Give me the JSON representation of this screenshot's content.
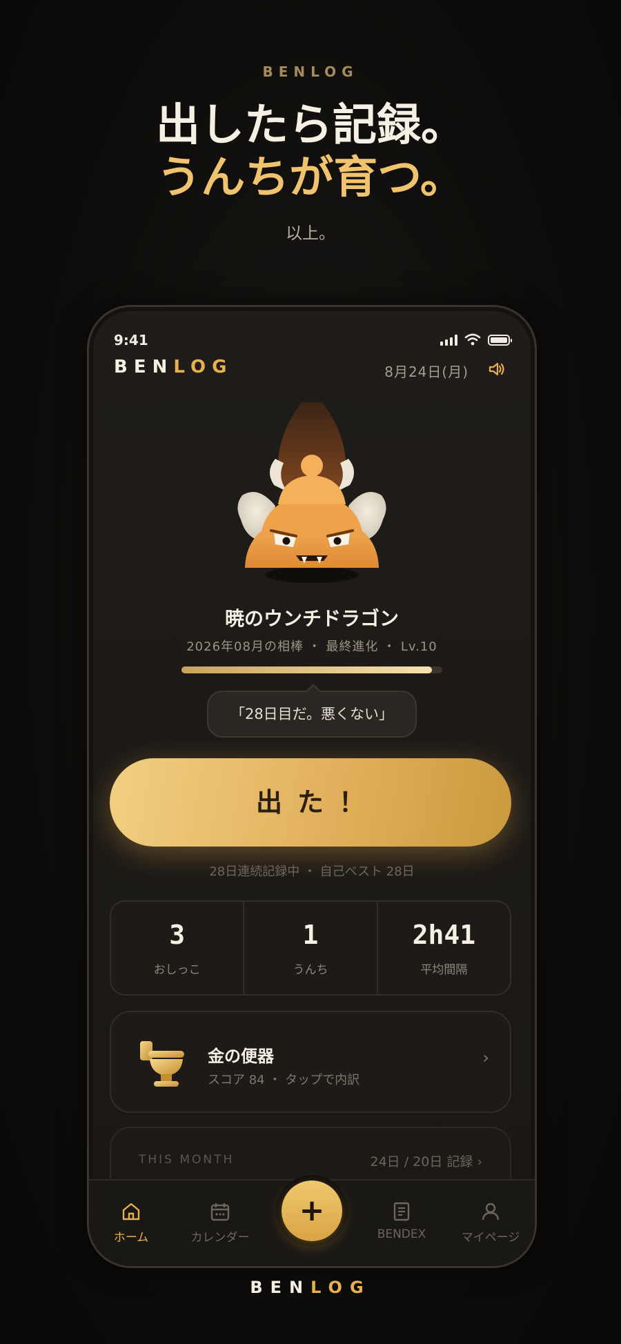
{
  "promo": {
    "brand": "BENLOG",
    "headline_1": "出したら記録。",
    "headline_2": "うんちが育つ。",
    "tagline": "以上。"
  },
  "status_bar": {
    "time": "9:41"
  },
  "header": {
    "logo_white": "BEN",
    "logo_gold": "LOG",
    "date": "8月24日(月)"
  },
  "pet": {
    "name": "暁のウンチドラゴン",
    "meta": "2026年08月の相棒 ・ 最終進化 ・ Lv.10",
    "xp_fraction": 0.96,
    "speech": "「28日目だ。悪くない」"
  },
  "cta": {
    "label": "出た！"
  },
  "streak": "28日連続記録中 ・ 自己ベスト 28日",
  "stats": [
    {
      "value": "3",
      "label": "おしっこ"
    },
    {
      "value": "1",
      "label": "うんち"
    },
    {
      "value": "2h41",
      "label": "平均間隔"
    }
  ],
  "toilet_card": {
    "title": "金の便器",
    "subtitle": "スコア 84 ・ タップで内訳",
    "chevron": "›"
  },
  "month_card": {
    "label": "THIS MONTH",
    "count": "24日 / 20日 記録 ›"
  },
  "tabs": [
    {
      "label": "ホーム",
      "icon": "home-icon"
    },
    {
      "label": "カレンダー",
      "icon": "calendar-icon"
    },
    {
      "label": "BENDEX",
      "icon": "book-icon"
    },
    {
      "label": "マイページ",
      "icon": "user-icon"
    }
  ],
  "fab": {
    "label": "+"
  },
  "footer": {
    "logo_white": "BEN",
    "logo_gold": "LOG"
  },
  "colors": {
    "accent": "#e9b04f",
    "background": "#0e0d0b",
    "card": "#1d1a17"
  }
}
